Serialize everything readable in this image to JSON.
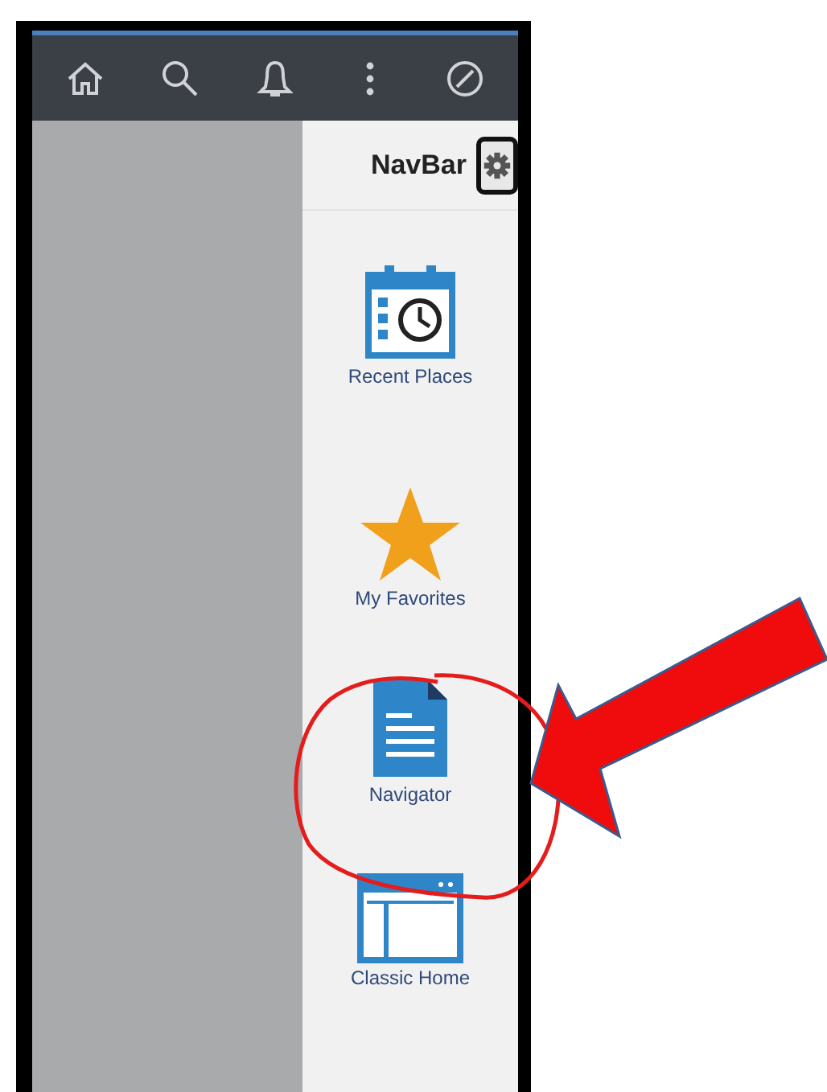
{
  "toolbar": {
    "buttons": [
      {
        "kind": "home"
      },
      {
        "kind": "search"
      },
      {
        "kind": "bell"
      },
      {
        "kind": "more"
      },
      {
        "kind": "compass"
      }
    ]
  },
  "navbar": {
    "title": "NavBar",
    "items": [
      {
        "kind": "recent",
        "label": "Recent Places"
      },
      {
        "kind": "favorites",
        "label": "My Favorites"
      },
      {
        "kind": "navigator",
        "label": "Navigator"
      },
      {
        "kind": "classic",
        "label": "Classic Home"
      }
    ]
  }
}
